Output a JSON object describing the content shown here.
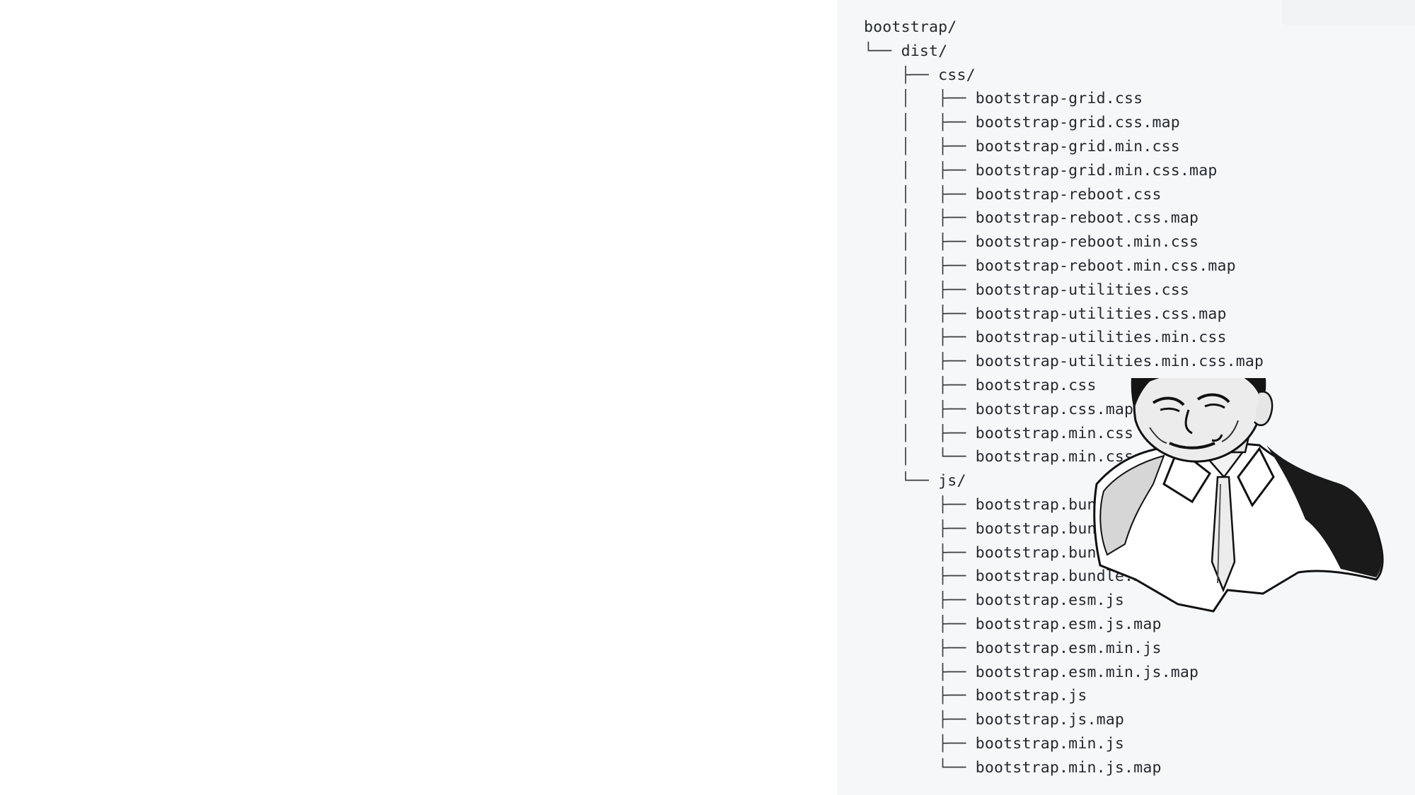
{
  "tree": {
    "lines": [
      {
        "prefix": "",
        "name": "bootstrap/"
      },
      {
        "prefix": "└── ",
        "name": "dist/"
      },
      {
        "prefix": "    ├── ",
        "name": "css/"
      },
      {
        "prefix": "    │   ├── ",
        "name": "bootstrap-grid.css"
      },
      {
        "prefix": "    │   ├── ",
        "name": "bootstrap-grid.css.map"
      },
      {
        "prefix": "    │   ├── ",
        "name": "bootstrap-grid.min.css"
      },
      {
        "prefix": "    │   ├── ",
        "name": "bootstrap-grid.min.css.map"
      },
      {
        "prefix": "    │   ├── ",
        "name": "bootstrap-reboot.css"
      },
      {
        "prefix": "    │   ├── ",
        "name": "bootstrap-reboot.css.map"
      },
      {
        "prefix": "    │   ├── ",
        "name": "bootstrap-reboot.min.css"
      },
      {
        "prefix": "    │   ├── ",
        "name": "bootstrap-reboot.min.css.map"
      },
      {
        "prefix": "    │   ├── ",
        "name": "bootstrap-utilities.css"
      },
      {
        "prefix": "    │   ├── ",
        "name": "bootstrap-utilities.css.map"
      },
      {
        "prefix": "    │   ├── ",
        "name": "bootstrap-utilities.min.css"
      },
      {
        "prefix": "    │   ├── ",
        "name": "bootstrap-utilities.min.css.map"
      },
      {
        "prefix": "    │   ├── ",
        "name": "bootstrap.css"
      },
      {
        "prefix": "    │   ├── ",
        "name": "bootstrap.css.map"
      },
      {
        "prefix": "    │   ├── ",
        "name": "bootstrap.min.css"
      },
      {
        "prefix": "    │   └── ",
        "name": "bootstrap.min.css.map"
      },
      {
        "prefix": "    └── ",
        "name": "js/"
      },
      {
        "prefix": "        ├── ",
        "name": "bootstrap.bundle.js"
      },
      {
        "prefix": "        ├── ",
        "name": "bootstrap.bundle.js.map"
      },
      {
        "prefix": "        ├── ",
        "name": "bootstrap.bundle.min.js"
      },
      {
        "prefix": "        ├── ",
        "name": "bootstrap.bundle.min.js.map"
      },
      {
        "prefix": "        ├── ",
        "name": "bootstrap.esm.js"
      },
      {
        "prefix": "        ├── ",
        "name": "bootstrap.esm.js.map"
      },
      {
        "prefix": "        ├── ",
        "name": "bootstrap.esm.min.js"
      },
      {
        "prefix": "        ├── ",
        "name": "bootstrap.esm.min.js.map"
      },
      {
        "prefix": "        ├── ",
        "name": "bootstrap.js"
      },
      {
        "prefix": "        ├── ",
        "name": "bootstrap.js.map"
      },
      {
        "prefix": "        ├── ",
        "name": "bootstrap.min.js"
      },
      {
        "prefix": "        └── ",
        "name": "bootstrap.min.js.map"
      }
    ]
  },
  "overlay": {
    "icon": "meme-face-icon"
  },
  "colors": {
    "page_bg": "#ffffff",
    "code_bg": "#f6f7f9",
    "text": "#24292f"
  }
}
